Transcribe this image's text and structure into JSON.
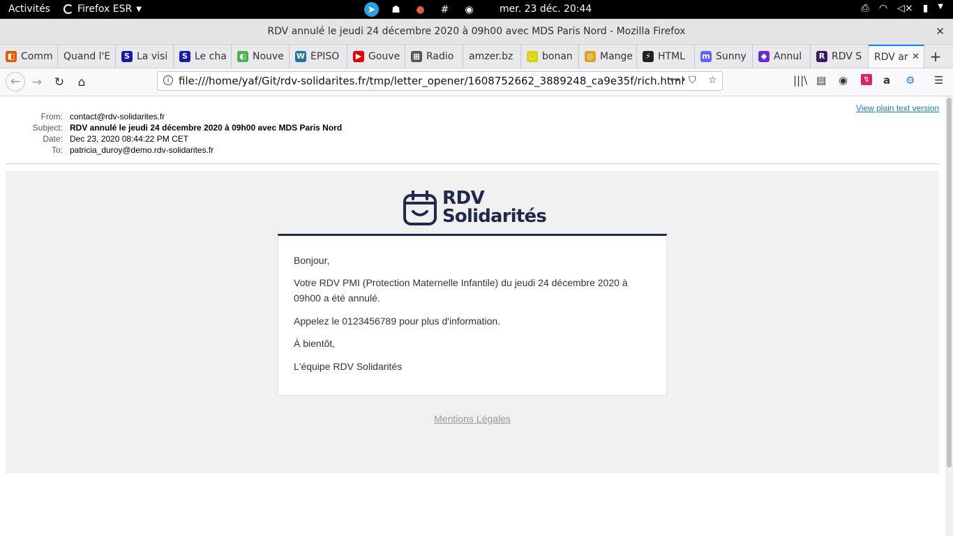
{
  "gnome": {
    "activities": "Activités",
    "app_name": "Firefox ESR",
    "clock": "mer. 23 déc.  20:44"
  },
  "window": {
    "title": "RDV annulé le jeudi 24 décembre 2020 à 09h00 avec MDS Paris Nord - Mozilla Firefox"
  },
  "tabs": [
    {
      "label": "Comm",
      "icon": "feed-icon",
      "color": "#e05a00"
    },
    {
      "label": "Quand l'E",
      "icon": "blank-icon",
      "color": "#ffffff"
    },
    {
      "label": "La visi",
      "icon": "s-icon",
      "color": "#1a1aa6"
    },
    {
      "label": "Le cha",
      "icon": "s-icon",
      "color": "#1a1aa6"
    },
    {
      "label": "Nouve",
      "icon": "leaf-icon",
      "color": "#4caf50"
    },
    {
      "label": "ÉPISO",
      "icon": "wordpress-icon",
      "color": "#21759b"
    },
    {
      "label": "Gouve",
      "icon": "youtube-icon",
      "color": "#e00000"
    },
    {
      "label": "Radio",
      "icon": "radio-icon",
      "color": "#555555"
    },
    {
      "label": "amzer.bz",
      "icon": "blank-icon",
      "color": "#ffffff"
    },
    {
      "label": "bonan",
      "icon": "circle-icon",
      "color": "#d4d400"
    },
    {
      "label": "Mange",
      "icon": "coin-icon",
      "color": "#e0a020"
    },
    {
      "label": "HTML",
      "icon": "bolt-icon",
      "color": "#222222"
    },
    {
      "label": "Sunny",
      "icon": "mastodon-icon",
      "color": "#6364ff"
    },
    {
      "label": "Annul",
      "icon": "mortarboard-icon",
      "color": "#6a2bd0"
    },
    {
      "label": "RDV S",
      "icon": "rdv-icon",
      "color": "#3a1a5a"
    },
    {
      "label": "RDV ar",
      "icon": "blank-icon",
      "color": "#ffffff"
    }
  ],
  "urlbar": {
    "url": "file:///home/yaf/Git/rdv-solidarites.fr/tmp/letter_opener/1608752662_3889248_ca9e35f/rich.html"
  },
  "letter": {
    "plain_link": "View plain text version",
    "headers": {
      "from_label": "From:",
      "from": "contact@rdv-solidarites.fr",
      "subject_label": "Subject:",
      "subject": "RDV annulé le jeudi 24 décembre 2020 à 09h00 avec MDS Paris Nord",
      "date_label": "Date:",
      "date": "Dec 23, 2020 08:44:22 PM CET",
      "to_label": "To:",
      "to": "patricia_duroy@demo.rdv-solidarites.fr"
    }
  },
  "email": {
    "logo_line1": "RDV",
    "logo_line2": "Solidarités",
    "greeting": "Bonjour,",
    "body": "Votre RDV PMI (Protection Maternelle Infantile) du jeudi 24 décembre 2020 à 09h00 a été annulé.",
    "call": "Appelez le 0123456789 pour plus d'information.",
    "closing": "À bientôt,",
    "signature": "L'équipe RDV Solidarités",
    "legal": "Mentions Légales",
    "brand_color": "#1e2a4a"
  }
}
